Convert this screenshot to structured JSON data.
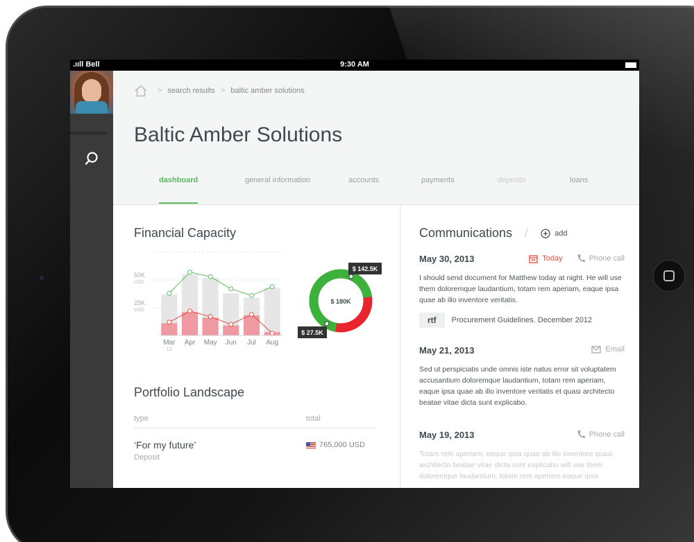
{
  "status_bar": {
    "carrier": ".ııll Bell",
    "time": "9:30 AM"
  },
  "breadcrumb": {
    "items": [
      "search results",
      "baltic amber solutions"
    ]
  },
  "page": {
    "title": "Baltic Amber Solutions"
  },
  "tabs": [
    {
      "label": "dashboard",
      "state": "active"
    },
    {
      "label": "general information",
      "state": "normal"
    },
    {
      "label": "accounts",
      "state": "normal"
    },
    {
      "label": "payments",
      "state": "normal"
    },
    {
      "label": "deposits",
      "state": "disabled"
    },
    {
      "label": "loans",
      "state": "normal"
    }
  ],
  "financial_capacity": {
    "title": "Financial Capacity"
  },
  "chart_data": [
    {
      "type": "bar",
      "categories": [
        "Mar",
        "Apr",
        "May",
        "Jun",
        "Jul",
        "Aug"
      ],
      "category_sublabels": [
        "13",
        "",
        "",
        "",
        "",
        ""
      ],
      "y_ticks": [
        {
          "label": "50K",
          "unit": "USD"
        },
        {
          "label": "25K",
          "unit": "USD"
        }
      ],
      "ylim": [
        0,
        75000
      ],
      "series": [
        {
          "values": [
            37000,
            55000,
            52000,
            38000,
            34000,
            43000
          ],
          "color": "#e6e6e6",
          "line_values": [
            38000,
            57000,
            53000,
            42000,
            36000,
            44000
          ],
          "line_color": "#5cb85c"
        },
        {
          "values": [
            11000,
            21000,
            16000,
            9000,
            18000,
            3000
          ],
          "color": "#ef9aa3",
          "line_values": [
            12000,
            22000,
            17000,
            10000,
            19000,
            2000
          ],
          "line_color": "#e74c3c"
        }
      ],
      "grid": true
    },
    {
      "type": "pie",
      "center_label": "$ 180K",
      "slices": [
        {
          "label": "$ 142.5K",
          "value": 142.5,
          "color": "#3bb23b"
        },
        {
          "label": "$ 27.5K",
          "value": 27.5,
          "color": "#e8242f"
        }
      ],
      "remainder_color": "#e8242f"
    }
  ],
  "portfolio": {
    "title": "Portfolio Landscape",
    "columns": [
      "type",
      "total"
    ],
    "rows": [
      {
        "name": "‘For my future’",
        "sub": "Deposit",
        "amount": "765,000 USD"
      }
    ]
  },
  "communications": {
    "title": "Communications",
    "add_label": "add",
    "entries": [
      {
        "date": "May 30, 2013",
        "today_label": "Today",
        "type": "Phone call",
        "body": "I should send document for Matthew today at night. He will use them doloremque laudantium, totam rem aperiam, eaque ipsa quae ab illo inventore veritatis.",
        "attachment_type": "rtf",
        "attachment_name": "Procurement Guidelines. December 2012"
      },
      {
        "date": "May 21, 2013",
        "type": "Email",
        "body": "Sed ut perspiciatis unde omnis iste natus error sit voluptatem accusantium doloremque laudantium, totam rem aperiam, eaque ipsa quae ab illo inventore veritatis et quasi architecto beatae vitae dicta sunt explicabo."
      },
      {
        "date": "May 19, 2013",
        "type": "Phone call",
        "body": "Totam rem aperiam, eaque ipsa quae ab illo inventore quasi architecto beatae vitae dicta sunt explicabo will use them doloremque laudantium, totam rem aperiam eaque ipsa"
      }
    ]
  },
  "colors": {
    "accent_green": "#5cb85c",
    "alert_red": "#e74c3c",
    "sidebar": "#3a3a3a"
  }
}
